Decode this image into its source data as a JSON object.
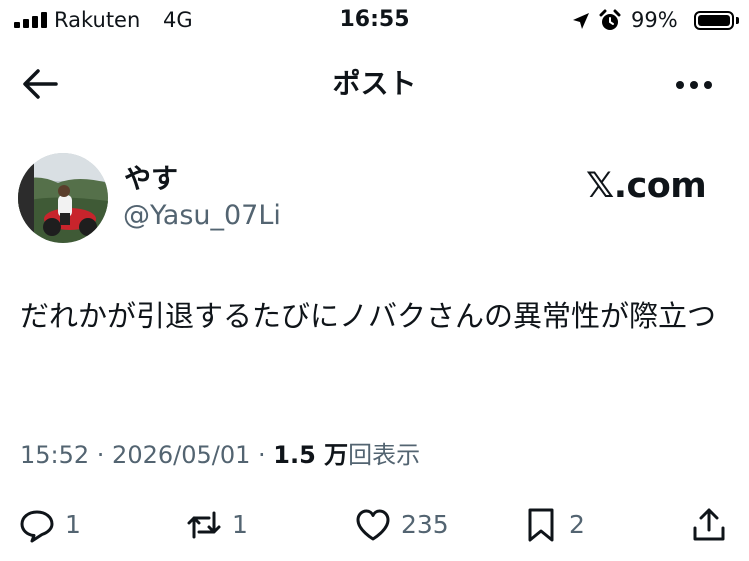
{
  "status_bar": {
    "carrier": "Rakuten",
    "network": "4G",
    "time": "16:55",
    "battery_percent": "99%",
    "battery_level": 0.99,
    "icons": [
      "signal-icon",
      "location-arrow-icon",
      "alarm-icon",
      "battery-icon"
    ]
  },
  "header": {
    "title": "ポスト",
    "icons": [
      "back-arrow-icon",
      "more-icon"
    ]
  },
  "post": {
    "author_name": "やす",
    "author_handle": "@Yasu_07Li",
    "brand": "𝕏.com",
    "text": "だれかが引退するたびにノバクさんの異常性が際立つ",
    "timestamp": "15:52 · 2026/05/01 · ",
    "views_count": "1.5 万",
    "views_label": "回表示"
  },
  "actions": {
    "reply_count": "1",
    "repost_count": "1",
    "like_count": "235",
    "bookmark_count": "2",
    "icons": [
      "reply-icon",
      "repost-icon",
      "like-icon",
      "bookmark-icon",
      "share-icon"
    ]
  },
  "colors": {
    "text_primary": "#0f1419",
    "text_secondary": "#536471",
    "background": "#ffffff"
  }
}
